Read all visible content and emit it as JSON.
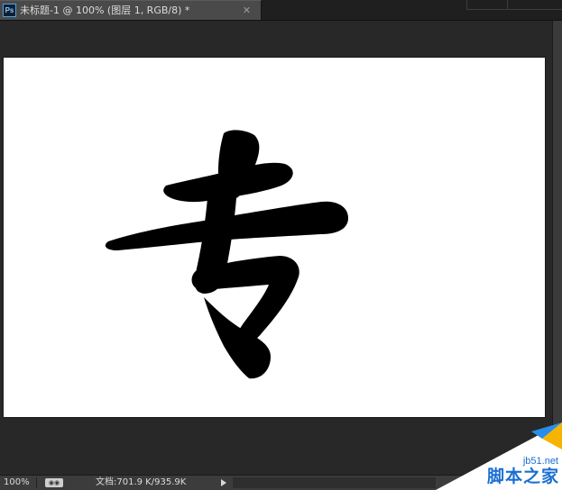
{
  "document_tab": {
    "app_icon": "ps-app-icon",
    "app_icon_text": "Ps",
    "title": "未标题-1 @ 100% (图层 1, RGB/8) *",
    "close_icon": "close-icon"
  },
  "canvas": {
    "background": "#ffffff",
    "stroke_color": "#000000"
  },
  "status_bar": {
    "zoom": "100%",
    "share_icon": "share-icon",
    "doc_size": "文档:701.9 K/935.9K",
    "menu_arrow": "play-arrow-icon"
  },
  "watermark": {
    "url": "jb51.net",
    "name": "脚本之家",
    "color": "#1a6fd1"
  }
}
